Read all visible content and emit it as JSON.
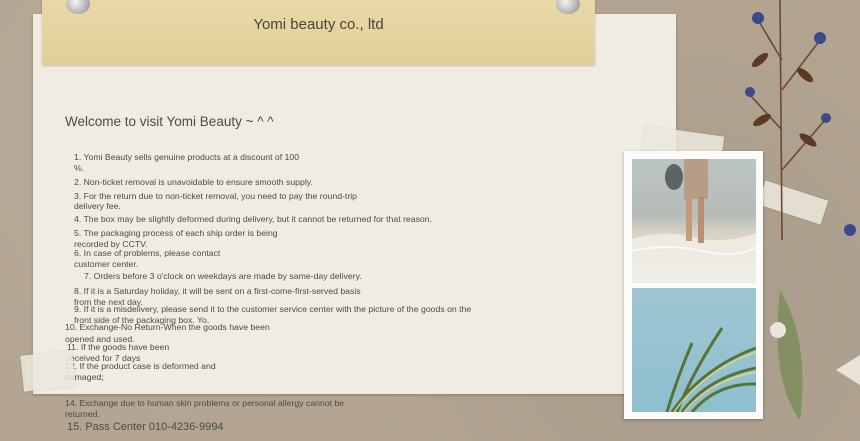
{
  "header": {
    "company_name": "Yomi beauty co., ltd"
  },
  "content": {
    "welcome": "Welcome to visit Yomi Beauty ~ ^ ^",
    "notice_lines": [
      "1. Yomi Beauty sells genuine products at a discount of 100",
      "%.",
      "2. Non-ticket removal is unavoidable to ensure smooth supply.",
      "3. For the return due to non-ticket removal, you need to pay the round-trip",
      "delivery fee.",
      "4. The box may be slightly deformed during delivery, but it cannot be returned for that reason.",
      "5. The packaging process of each ship order is being",
      "recorded by CCTV.",
      "6. In case of problems, please contact",
      "customer center.",
      "7. Orders before 3 o'clock on weekdays are made by same-day delivery.",
      "8. If it is a Saturday holiday, it will be sent on a first-come-first-served basis",
      "from the next day.",
      "9. If it is a misdelivery, please send it to the customer service center with the picture of the goods on the",
      "front side of the packaging box. Yo.",
      "10. Exchange-No Return-When the goods have been",
      "opened and used.",
      "11. If the goods have been",
      "received for 7 days",
      "12. If the product case is deformed and",
      "damaged;",
      "14. Exchange due to human skin problems or personal allergy cannot be",
      "returned.",
      "15. Pass Center 010-4236-9994"
    ]
  },
  "colors": {
    "background": "#b3a592",
    "paper": "#f1ece1",
    "header_tape": "#e6d6a4"
  }
}
